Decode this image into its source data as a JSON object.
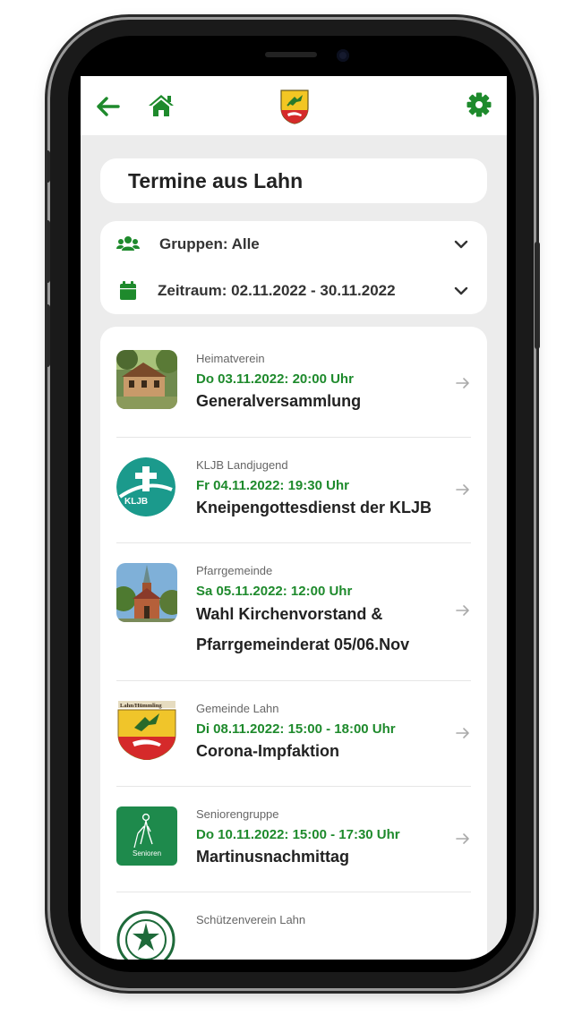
{
  "header": {
    "back_icon": "arrow-left-icon",
    "home_icon": "home-icon",
    "logo_icon": "coat-of-arms-icon",
    "settings_icon": "gear-icon",
    "accent_color": "#1e8a2c"
  },
  "page": {
    "title": "Termine aus Lahn"
  },
  "filters": {
    "groups_label": "Gruppen: Alle",
    "period_label": "Zeitraum: 02.11.2022 - 30.11.2022"
  },
  "events": [
    {
      "group": "Heimatverein",
      "date": "Do 03.11.2022: 20:00 Uhr",
      "title": "Generalversammlung",
      "thumbnail": "house-photo"
    },
    {
      "group": "KLJB Landjugend",
      "date": "Fr 04.11.2022: 19:30 Uhr",
      "title": "Kneipengottesdienst der KLJB",
      "thumbnail": "kljb-logo"
    },
    {
      "group": "Pfarrgemeinde",
      "date": "Sa 05.11.2022: 12:00 Uhr",
      "title": "Wahl Kirchenvorstand & Pfarrgemeinderat 05/06.Nov",
      "thumbnail": "church-photo"
    },
    {
      "group": "Gemeinde Lahn",
      "date": "Di 08.11.2022: 15:00 - 18:00 Uhr",
      "title": "Corona-Impfaktion",
      "thumbnail": "coat-of-arms",
      "thumb_caption": "Lahn/Hümmling"
    },
    {
      "group": "Seniorengruppe",
      "date": "Do 10.11.2022: 15:00 - 17:30 Uhr",
      "title": "Martinusnachmittag",
      "thumbnail": "senioren-logo",
      "thumb_caption": "Senioren"
    },
    {
      "group": "Schützenverein Lahn",
      "thumbnail": "schuetzen-logo"
    }
  ]
}
